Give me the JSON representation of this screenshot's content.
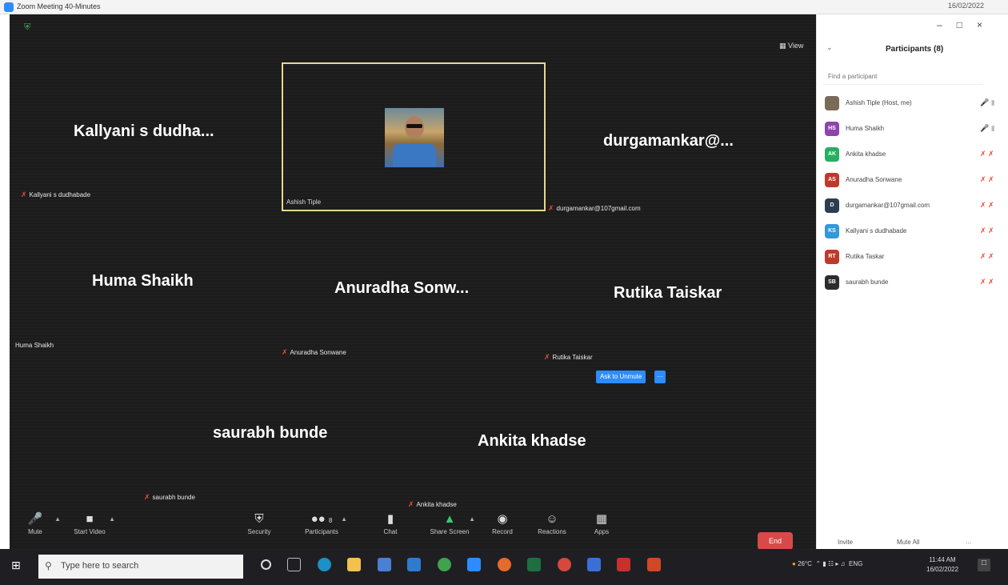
{
  "window": {
    "title": "Zoom Meeting 40-Minutes",
    "date_top": "16/02/2022",
    "view_label": "View"
  },
  "tiles": {
    "big_names": [
      "Kallyani s dudha...",
      "durgamankar@...",
      "Huma Shaikh",
      "Anuradha Sonw...",
      "Rutika Taiskar",
      "saurabh bunde",
      "Ankita khadse"
    ],
    "small_labels": [
      "Kallyani s dudhabade",
      "durgamankar@107gmail.com",
      "Huma Shaikh",
      "Anuradha Sonwane",
      "Rutika Taiskar",
      "saurabh bunde",
      "Ankita khadse"
    ],
    "active_speaker_label": "Ashish Tiple"
  },
  "ask_to_unmute_label": "Ask to Unmute",
  "toolbar": {
    "mute": "Mute",
    "start_video": "Start Video",
    "security": "Security",
    "participants": "Participants",
    "participants_count": "8",
    "chat": "Chat",
    "share_screen": "Share Screen",
    "record": "Record",
    "reactions": "Reactions",
    "apps": "Apps",
    "end": "End"
  },
  "panel": {
    "title": "Participants (8)",
    "search_placeholder": "Find a participant",
    "participants": [
      {
        "initials": "",
        "name": "Ashish Tiple (Host, me)",
        "color": "#7a6a58",
        "muted": false
      },
      {
        "initials": "HS",
        "name": "Huma Shaikh",
        "color": "#8e44ad",
        "muted": false
      },
      {
        "initials": "AK",
        "name": "Ankita khadse",
        "color": "#27ae60",
        "muted": true
      },
      {
        "initials": "AS",
        "name": "Anuradha Sonwane",
        "color": "#c0392b",
        "muted": true
      },
      {
        "initials": "D",
        "name": "durgamankar@107gmail.com",
        "color": "#2c3e50",
        "muted": true
      },
      {
        "initials": "KS",
        "name": "Kallyani s dudhabade",
        "color": "#3498db",
        "muted": true
      },
      {
        "initials": "RT",
        "name": "Rutika Taskar",
        "color": "#c0392b",
        "muted": true
      },
      {
        "initials": "SB",
        "name": "saurabh bunde",
        "color": "#2c2c2c",
        "muted": true
      }
    ],
    "invite": "Invite",
    "mute_all": "Mute All",
    "more": "..."
  },
  "taskbar": {
    "search_placeholder": "Type here to search",
    "temperature": "26°C",
    "language": "ENG",
    "time": "11:44 AM",
    "date": "16/02/2022"
  }
}
